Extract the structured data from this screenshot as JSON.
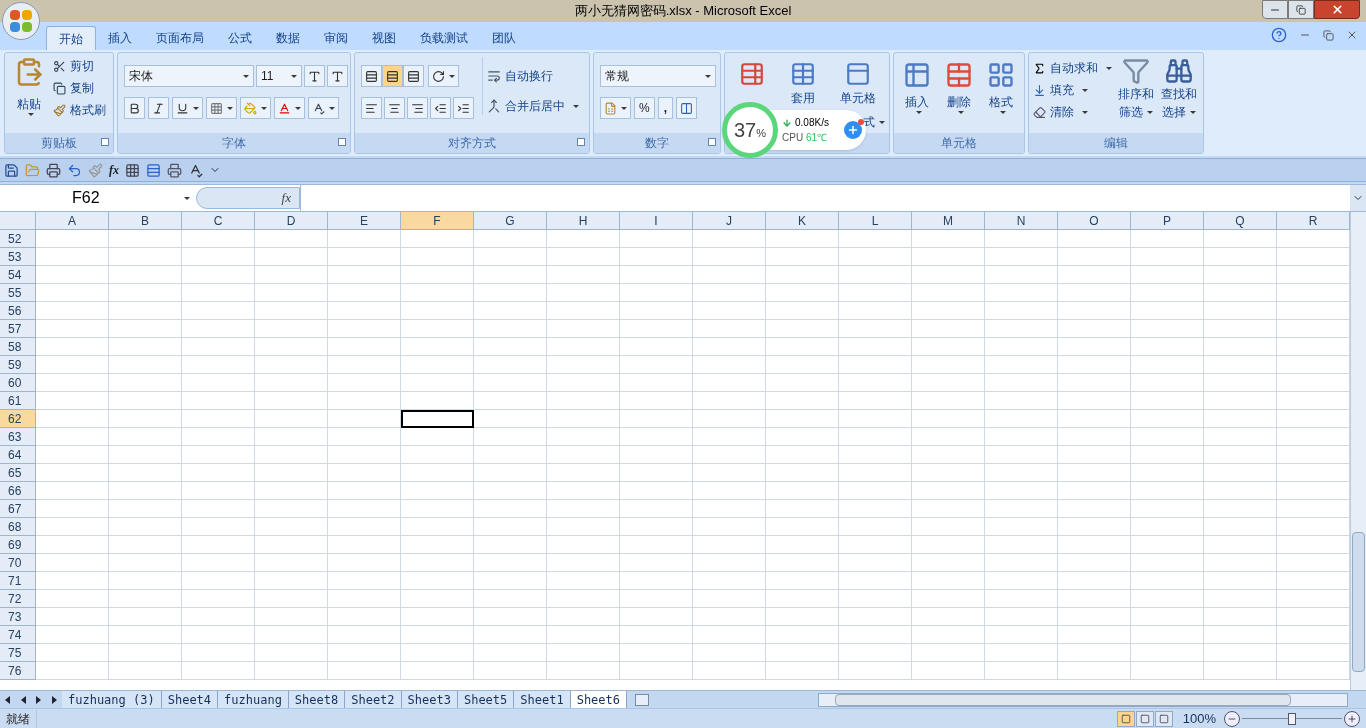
{
  "window": {
    "title": "两小无猜网密码.xlsx - Microsoft Excel"
  },
  "tabs": [
    {
      "label": "开始",
      "selected": true
    },
    {
      "label": "插入",
      "selected": false
    },
    {
      "label": "页面布局",
      "selected": false
    },
    {
      "label": "公式",
      "selected": false
    },
    {
      "label": "数据",
      "selected": false
    },
    {
      "label": "审阅",
      "selected": false
    },
    {
      "label": "视图",
      "selected": false
    },
    {
      "label": "负载测试",
      "selected": false
    },
    {
      "label": "团队",
      "selected": false
    }
  ],
  "clipboard": {
    "paste": "粘贴",
    "cut": "剪切",
    "copy": "复制",
    "format_painter": "格式刷",
    "label": "剪贴板"
  },
  "font": {
    "font_name": "宋体",
    "font_size": "11",
    "label": "字体"
  },
  "alignment": {
    "vertical": [
      {
        "selected": false
      },
      {
        "selected": true
      },
      {
        "selected": false
      }
    ],
    "wrap_text": "自动换行",
    "merge_center": "合并后居中",
    "label": "对齐方式"
  },
  "number": {
    "format": "常规",
    "percent": "%",
    "comma": ",",
    "label": "数字"
  },
  "styles": {
    "format_as_table": "套用",
    "cell_styles": "单元格",
    "cell_styles_line2": "式"
  },
  "cells": {
    "buttons": [
      "插入",
      "删除",
      "格式"
    ],
    "label": "单元格"
  },
  "editing": {
    "autosum": "自动求和",
    "fill": "填充",
    "clear": "清除",
    "sort": [
      "排序和",
      "筛选"
    ],
    "find": [
      "查找和",
      "选择"
    ],
    "label": "编辑"
  },
  "monitor": {
    "percent": "37",
    "unit": "%",
    "speed": "0.08K/s",
    "cpu_label": "CPU",
    "temperature": "61℃"
  },
  "quick_access": {
    "function_label": "fx"
  },
  "formula_bar": {
    "name_box": "F62",
    "function_label": "fx"
  },
  "sheet": {
    "columns": [
      {
        "label": "A",
        "selected": false
      },
      {
        "label": "B",
        "selected": false
      },
      {
        "label": "C",
        "selected": false
      },
      {
        "label": "D",
        "selected": false
      },
      {
        "label": "E",
        "selected": false
      },
      {
        "label": "F",
        "selected": true
      },
      {
        "label": "G",
        "selected": false
      },
      {
        "label": "H",
        "selected": false
      },
      {
        "label": "I",
        "selected": false
      },
      {
        "label": "J",
        "selected": false
      },
      {
        "label": "K",
        "selected": false
      },
      {
        "label": "L",
        "selected": false
      },
      {
        "label": "M",
        "selected": false
      },
      {
        "label": "N",
        "selected": false
      },
      {
        "label": "O",
        "selected": false
      },
      {
        "label": "P",
        "selected": false
      },
      {
        "label": "Q",
        "selected": false
      },
      {
        "label": "R",
        "selected": false
      }
    ],
    "rows": [
      {
        "label": "52",
        "selected": false
      },
      {
        "label": "53",
        "selected": false
      },
      {
        "label": "54",
        "selected": false
      },
      {
        "label": "55",
        "selected": false
      },
      {
        "label": "56",
        "selected": false
      },
      {
        "label": "57",
        "selected": false
      },
      {
        "label": "58",
        "selected": false
      },
      {
        "label": "59",
        "selected": false
      },
      {
        "label": "60",
        "selected": false
      },
      {
        "label": "61",
        "selected": false
      },
      {
        "label": "62",
        "selected": true
      },
      {
        "label": "63",
        "selected": false
      },
      {
        "label": "64",
        "selected": false
      },
      {
        "label": "65",
        "selected": false
      },
      {
        "label": "66",
        "selected": false
      },
      {
        "label": "67",
        "selected": false
      },
      {
        "label": "68",
        "selected": false
      },
      {
        "label": "69",
        "selected": false
      },
      {
        "label": "70",
        "selected": false
      },
      {
        "label": "71",
        "selected": false
      },
      {
        "label": "72",
        "selected": false
      },
      {
        "label": "73",
        "selected": false
      },
      {
        "label": "74",
        "selected": false
      },
      {
        "label": "75",
        "selected": false
      },
      {
        "label": "76",
        "selected": false
      }
    ]
  },
  "sheet_tabs": [
    {
      "label": "fuzhuang (3)",
      "selected": false
    },
    {
      "label": "Sheet4",
      "selected": false
    },
    {
      "label": "fuzhuang",
      "selected": false
    },
    {
      "label": "Sheet8",
      "selected": false
    },
    {
      "label": "Sheet2",
      "selected": false
    },
    {
      "label": "Sheet3",
      "selected": false
    },
    {
      "label": "Sheet5",
      "selected": false
    },
    {
      "label": "Sheet1",
      "selected": false
    },
    {
      "label": "Sheet6",
      "selected": true
    }
  ],
  "status_bar": {
    "status": "就绪",
    "views": [
      {
        "selected": true
      },
      {
        "selected": false
      },
      {
        "selected": false
      }
    ],
    "zoom": "100%",
    "zoom_slider": {
      "level": 0.5
    }
  }
}
